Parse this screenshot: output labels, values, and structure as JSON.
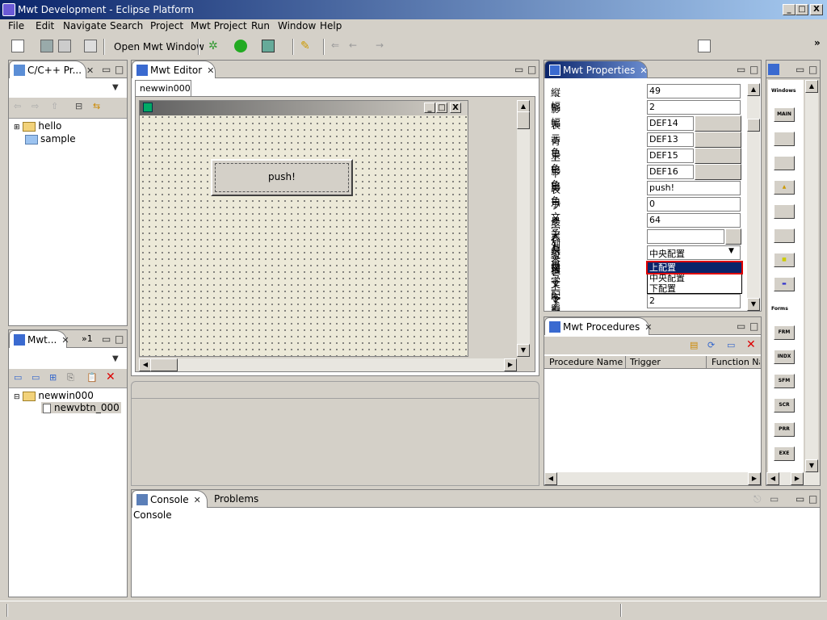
{
  "window": {
    "title": "Mwt Development - Eclipse Platform",
    "min": "_",
    "max": "□",
    "close": "X"
  },
  "menu": [
    "File",
    "Edit",
    "Navigate",
    "Search",
    "Project",
    "Mwt Project",
    "Run",
    "Window",
    "Help"
  ],
  "toolbar": {
    "open_window": "Open Mwt Window",
    "chevron": "»"
  },
  "project_view": {
    "tab": "C/C++ Pr...",
    "items": [
      "hello",
      "sample"
    ]
  },
  "mwt_view": {
    "tab": "Mwt...",
    "overflow": "»1",
    "items": [
      "newwin000",
      "newvbtn_000"
    ]
  },
  "editor": {
    "tab": "Mwt Editor",
    "subtab": "newwin000",
    "button_label": "push!"
  },
  "properties": {
    "tab": "Mwt Properties",
    "rows": [
      {
        "label": "縦幅",
        "value": "49"
      },
      {
        "label": "影幅",
        "value": "2"
      },
      {
        "label": "表示色",
        "value": "DEF14"
      },
      {
        "label": "背景色",
        "value": "DEF13"
      },
      {
        "label": "上影色",
        "value": "DEF15"
      },
      {
        "label": "下影色",
        "value": "DEF16"
      },
      {
        "label": "表示文字列",
        "value": "push!"
      },
      {
        "label": "フォント番号",
        "value": "0"
      },
      {
        "label": "最大長",
        "value": "64"
      },
      {
        "label": "表示画",
        "value": ""
      },
      {
        "label": "縦文字配置",
        "value": "中央配置"
      },
      {
        "label": "横文字配置",
        "value": ""
      },
      {
        "label": "上マージン",
        "value": ""
      },
      {
        "label": "下マージン",
        "value": "2"
      }
    ],
    "dropdown_options": [
      "上配置",
      "中央配置",
      "下配置"
    ]
  },
  "procedures": {
    "tab": "Mwt Procedures",
    "columns": [
      "Procedure Name",
      "Trigger",
      "Function Na"
    ]
  },
  "palette": {
    "section1": "Windows",
    "section2": "Forms",
    "items": [
      "MAIN",
      "",
      "",
      "",
      "",
      "",
      "",
      "",
      "FRM",
      "INDX",
      "SFM",
      "SCR",
      "PRR",
      "EXE"
    ]
  },
  "console": {
    "tab": "Console",
    "tab2": "Problems",
    "label": "Console"
  },
  "colors": {
    "title_start": "#0a246a",
    "title_end": "#a6caf0",
    "selection": "#0a246a",
    "highlight": "#e00000"
  }
}
